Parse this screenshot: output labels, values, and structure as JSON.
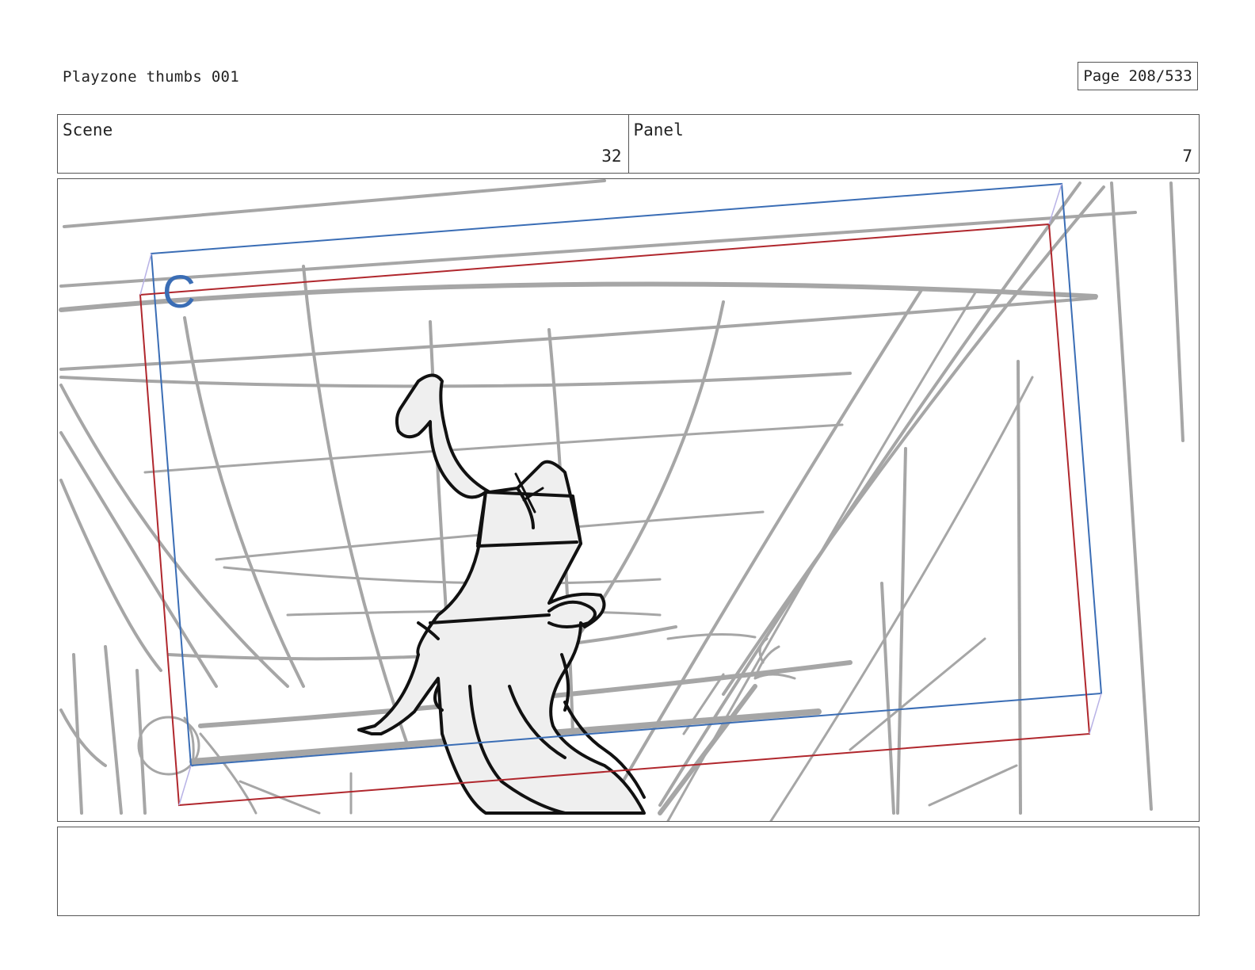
{
  "header": {
    "document_title": "Playzone thumbs 001",
    "page_indicator": "Page 208/533"
  },
  "fields": {
    "scene_label": "Scene",
    "scene_value": "32",
    "panel_label": "Panel",
    "panel_value": "7"
  },
  "drawing": {
    "camera_marker": "C",
    "colors": {
      "background_lines": "#a6a6a6",
      "character_line": "#111111",
      "character_fill": "#efefef",
      "camera_frame_start": "#3a6db5",
      "camera_frame_end": "#b0272d"
    }
  },
  "notes": {
    "text": ""
  }
}
